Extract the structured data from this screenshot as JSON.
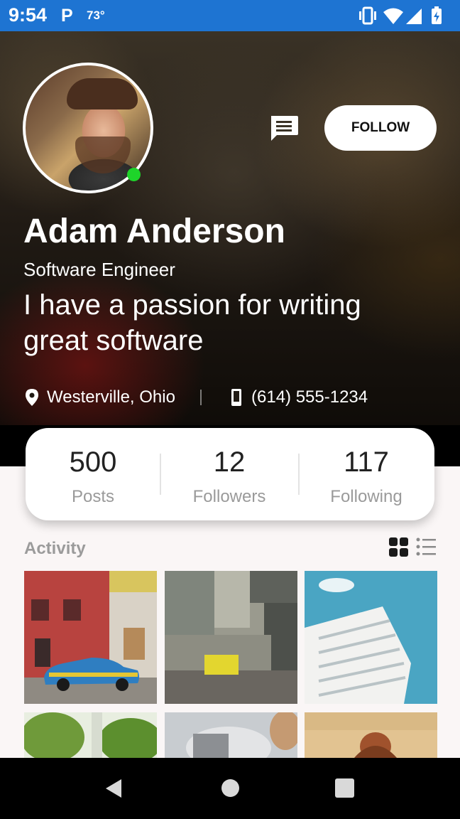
{
  "status_bar": {
    "time": "9:54",
    "app_icon": "P",
    "temperature": "73°",
    "icons": [
      "vibrate-icon",
      "wifi-icon",
      "signal-icon",
      "battery-icon"
    ]
  },
  "profile": {
    "name": "Adam Anderson",
    "title": "Software Engineer",
    "bio": "I have a passion for writing great software",
    "location": "Westerville, Ohio",
    "phone": "(614) 555-1234",
    "online": true,
    "follow_label": "FOLLOW"
  },
  "stats": [
    {
      "value": "500",
      "label": "Posts"
    },
    {
      "value": "12",
      "label": "Followers"
    },
    {
      "value": "117",
      "label": "Following"
    }
  ],
  "activity": {
    "heading": "Activity",
    "thumbnails": [
      "street-car-photo",
      "concrete-plaza-photo",
      "white-building-photo",
      "trees-photo",
      "woman-photo",
      "sunset-person-photo"
    ]
  },
  "colors": {
    "status_bar": "#1e74d2",
    "online": "#1ed42a",
    "page_bg": "#faf6f6"
  }
}
